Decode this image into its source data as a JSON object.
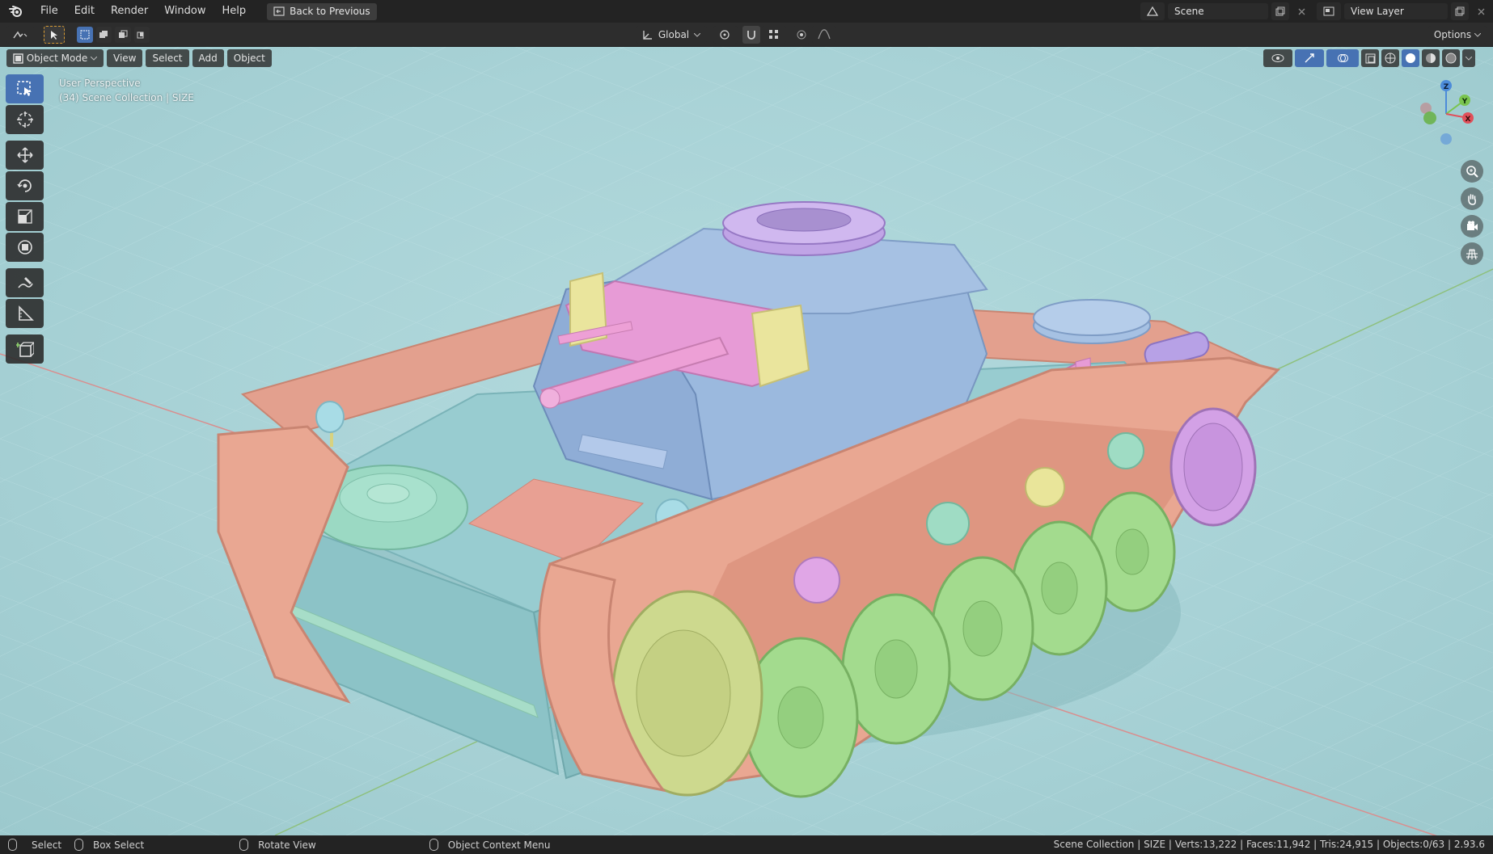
{
  "menu": {
    "items": [
      "File",
      "Edit",
      "Render",
      "Window",
      "Help"
    ],
    "back_label": "Back to Previous"
  },
  "scene": {
    "name": "Scene",
    "view_layer": "View Layer"
  },
  "tool_header": {
    "orientation": "Global",
    "options": "Options"
  },
  "viewport_header": {
    "mode": "Object Mode",
    "view": "View",
    "select": "Select",
    "add": "Add",
    "object": "Object"
  },
  "overlay": {
    "perspective": "User Perspective",
    "collection": "(34) Scene Collection | SIZE"
  },
  "toolbar": {
    "tools": [
      "select-box",
      "cursor",
      "move",
      "rotate",
      "scale",
      "transform",
      "annotate",
      "measure",
      "add-cube"
    ]
  },
  "gizmo": {
    "x": "X",
    "y": "Y",
    "z": "Z"
  },
  "status": {
    "select": "Select",
    "box_select": "Box Select",
    "rotate_view": "Rotate View",
    "context_menu": "Object Context Menu",
    "stats": "Scene Collection | SIZE | Verts:13,222 | Faces:11,942 | Tris:24,915 | Objects:0/63 | 2.93.6"
  },
  "colors": {
    "hull": "#8fc7cc",
    "turret": "#93b3db",
    "track": "#e8a592",
    "wheel": "#9dd98a",
    "wheel_front": "#c7d68c",
    "pink": "#e29ad6",
    "yellow": "#e9e59a",
    "purple": "#b99ae0",
    "mint": "#9fdcc4",
    "accent": "#4772b3"
  }
}
